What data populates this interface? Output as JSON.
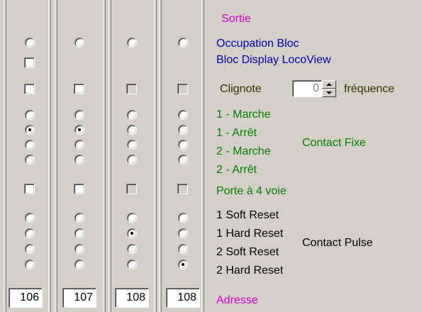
{
  "colors": {
    "magenta": "#cc00cc",
    "navy": "#0000aa",
    "olive": "#333300",
    "green": "#008000",
    "black": "#000000",
    "background": "#d4d0c8"
  },
  "columns": [
    {
      "sortie_radio": false,
      "bloc_display_checkbox": false,
      "clignote_checkbox": false,
      "contact_fixe": [
        false,
        true,
        false,
        false
      ],
      "porte_checkbox": false,
      "contact_pulse": [
        false,
        false,
        false,
        false
      ],
      "address": "106"
    },
    {
      "sortie_radio": false,
      "clignote_checkbox": false,
      "contact_fixe": [
        false,
        true,
        false,
        false
      ],
      "porte_checkbox": false,
      "contact_pulse": [
        false,
        false,
        false,
        false
      ],
      "address": "107"
    },
    {
      "sortie_radio": false,
      "clignote_checkbox": false,
      "contact_fixe": [
        false,
        false,
        false,
        false
      ],
      "porte_checkbox": false,
      "contact_pulse": [
        false,
        true,
        false,
        false
      ],
      "address": "108"
    },
    {
      "sortie_radio": false,
      "clignote_checkbox": false,
      "contact_fixe": [
        false,
        false,
        false,
        false
      ],
      "porte_checkbox": false,
      "contact_pulse": [
        false,
        false,
        false,
        true
      ],
      "address": "108"
    }
  ],
  "labels": {
    "sortie": "Sortie",
    "occupation_bloc": "Occupation Bloc",
    "bloc_display": "Bloc Display LocoView",
    "clignote": "Clignote",
    "frequence": "fréquence",
    "frequency_value": "0",
    "marche1": "1 - Marche",
    "arret1": "1 - Arrêt",
    "marche2": "2 - Marche",
    "arret2": "2 - Arrêt",
    "contact_fixe": "Contact Fixe",
    "porte": "Porte à 4 voie",
    "soft1": "1 Soft Reset",
    "hard1": "1 Hard Reset",
    "soft2": "2 Soft Reset",
    "hard2": "2 Hard Reset",
    "contact_pulse": "Contact Pulse",
    "adresse": "Adresse"
  }
}
